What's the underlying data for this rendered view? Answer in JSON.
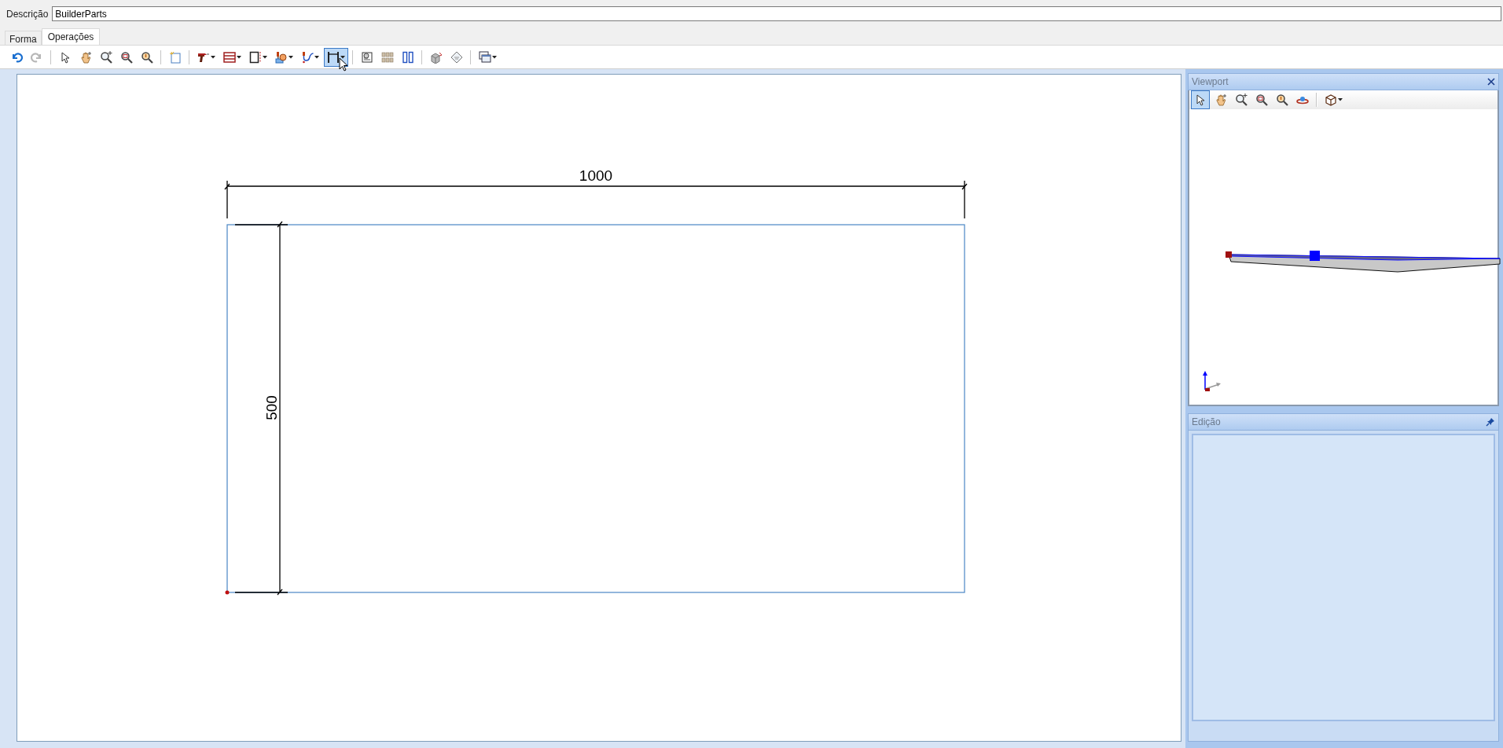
{
  "description": {
    "label": "Descrição",
    "value": "BuilderParts"
  },
  "tabs": [
    {
      "label": "Forma",
      "selected": false
    },
    {
      "label": "Operações",
      "selected": true
    }
  ],
  "toolbar": {
    "groups": [
      [
        {
          "kind": "undo",
          "dropdown": false,
          "highlighted": false,
          "disabled": false
        },
        {
          "kind": "redo",
          "dropdown": false,
          "highlighted": false,
          "disabled": true
        }
      ],
      [
        {
          "kind": "pointer",
          "dropdown": false,
          "highlighted": false,
          "disabled": false
        },
        {
          "kind": "pan",
          "dropdown": false,
          "highlighted": false,
          "disabled": false
        },
        {
          "kind": "zoom-extents",
          "dropdown": false,
          "highlighted": false,
          "disabled": false
        },
        {
          "kind": "zoom-window",
          "dropdown": false,
          "highlighted": false,
          "disabled": false
        },
        {
          "kind": "zoom",
          "dropdown": false,
          "highlighted": false,
          "disabled": false
        }
      ],
      [
        {
          "kind": "new-sheet",
          "dropdown": false,
          "highlighted": false,
          "disabled": false
        }
      ],
      [
        {
          "kind": "drill",
          "dropdown": true,
          "highlighted": false,
          "disabled": false
        },
        {
          "kind": "lines",
          "dropdown": true,
          "highlighted": false,
          "disabled": false
        },
        {
          "kind": "panel",
          "dropdown": true,
          "highlighted": false,
          "disabled": false
        },
        {
          "kind": "mill",
          "dropdown": true,
          "highlighted": false,
          "disabled": false
        },
        {
          "kind": "curve",
          "dropdown": true,
          "highlighted": false,
          "disabled": false
        },
        {
          "kind": "dimension",
          "dropdown": true,
          "highlighted": true,
          "disabled": false
        }
      ],
      [
        {
          "kind": "sheet-gear",
          "dropdown": false,
          "highlighted": false,
          "disabled": false
        },
        {
          "kind": "grid",
          "dropdown": false,
          "highlighted": false,
          "disabled": false
        },
        {
          "kind": "columns",
          "dropdown": false,
          "highlighted": false,
          "disabled": false
        }
      ],
      [
        {
          "kind": "box",
          "dropdown": false,
          "highlighted": false,
          "disabled": false
        },
        {
          "kind": "tag",
          "dropdown": false,
          "highlighted": false,
          "disabled": false
        }
      ],
      [
        {
          "kind": "windows",
          "dropdown": true,
          "highlighted": false,
          "disabled": false
        }
      ]
    ]
  },
  "drawing": {
    "width_dimension": "1000",
    "height_dimension": "500"
  },
  "viewport": {
    "title": "Viewport",
    "toolbar": {
      "groups": [
        [
          {
            "kind": "pointer",
            "dropdown": false,
            "highlighted": true,
            "disabled": false
          },
          {
            "kind": "pan",
            "dropdown": false,
            "highlighted": false,
            "disabled": false
          },
          {
            "kind": "zoom-extents",
            "dropdown": false,
            "highlighted": false,
            "disabled": false
          },
          {
            "kind": "zoom-window",
            "dropdown": false,
            "highlighted": false,
            "disabled": false
          },
          {
            "kind": "zoom",
            "dropdown": false,
            "highlighted": false,
            "disabled": false
          },
          {
            "kind": "orbit",
            "dropdown": false,
            "highlighted": false,
            "disabled": false
          }
        ],
        [
          {
            "kind": "cube",
            "dropdown": true,
            "highlighted": false,
            "disabled": false
          }
        ]
      ]
    }
  },
  "edit_panel": {
    "title": "Edição"
  }
}
